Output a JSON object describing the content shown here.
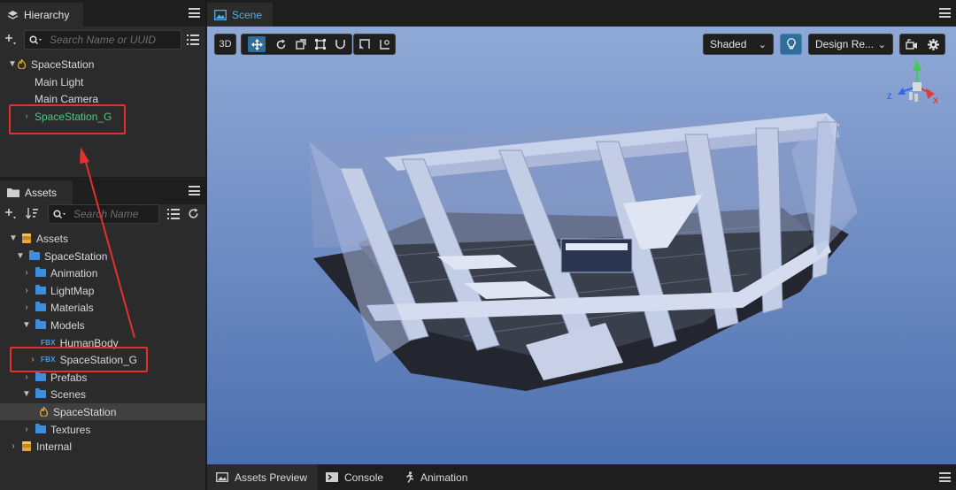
{
  "hierarchy": {
    "tab_label": "Hierarchy",
    "search_placeholder": "Search Name or UUID",
    "nodes": [
      {
        "label": "SpaceStation"
      },
      {
        "label": "Main Light"
      },
      {
        "label": "Main Camera"
      },
      {
        "label": "SpaceStation_G"
      }
    ]
  },
  "assets": {
    "tab_label": "Assets",
    "search_placeholder": "Search Name",
    "items": [
      {
        "label": "Assets"
      },
      {
        "label": "SpaceStation"
      },
      {
        "label": "Animation"
      },
      {
        "label": "LightMap"
      },
      {
        "label": "Materials"
      },
      {
        "label": "Models"
      },
      {
        "label": "HumanBody",
        "badge": "FBX"
      },
      {
        "label": "SpaceStation_G",
        "badge": "FBX"
      },
      {
        "label": "Prefabs"
      },
      {
        "label": "Scenes"
      },
      {
        "label": "SpaceStation"
      },
      {
        "label": "Textures"
      },
      {
        "label": "Internal"
      }
    ]
  },
  "scene": {
    "tab_label": "Scene",
    "toolbar": {
      "mode_3d": "3D",
      "shading": "Shaded",
      "resolution": "Design Re..."
    },
    "gizmo": {
      "x": "X",
      "y": "Y",
      "z": "Z"
    }
  },
  "bottom_tabs": [
    {
      "label": "Assets Preview"
    },
    {
      "label": "Console"
    },
    {
      "label": "Animation"
    }
  ],
  "colors": {
    "selection_text": "#4ec98a",
    "annotation_red": "#e53030",
    "accent_blue": "#2f6e9b",
    "viewport_top": "#8fa9d6",
    "viewport_bottom": "#4c6fae"
  }
}
